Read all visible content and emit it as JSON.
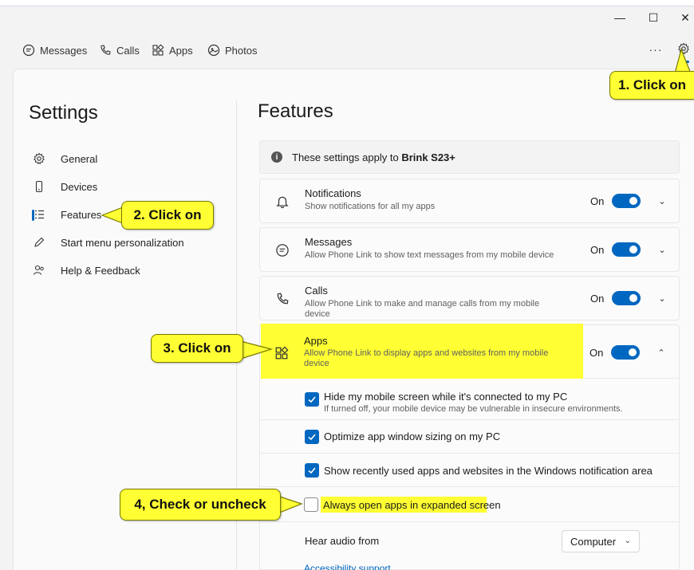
{
  "window": {
    "minimize_label": "—",
    "maximize_label": "☐",
    "close_label": "✕"
  },
  "nav": {
    "items": [
      {
        "label": "Messages",
        "icon": "messages-icon"
      },
      {
        "label": "Calls",
        "icon": "phone-icon"
      },
      {
        "label": "Apps",
        "icon": "apps-icon"
      },
      {
        "label": "Photos",
        "icon": "photos-icon"
      }
    ],
    "more_label": "···"
  },
  "sidebar": {
    "title": "Settings",
    "items": [
      {
        "label": "General",
        "icon": "gear-icon"
      },
      {
        "label": "Devices",
        "icon": "phone-device-icon"
      },
      {
        "label": "Features",
        "icon": "list-icon",
        "selected": true
      },
      {
        "label": "Start menu personalization",
        "icon": "pen-icon"
      },
      {
        "label": "Help & Feedback",
        "icon": "people-icon"
      }
    ]
  },
  "main": {
    "title": "Features",
    "info": {
      "prefix": "These settings apply to ",
      "device": "Brink S23+"
    },
    "features": [
      {
        "title": "Notifications",
        "desc": "Show notifications for all my apps",
        "state": "On",
        "icon": "bell-icon"
      },
      {
        "title": "Messages",
        "desc": "Allow Phone Link to show text messages from my mobile device",
        "state": "On",
        "icon": "chat-icon"
      },
      {
        "title": "Calls",
        "desc": "Allow Phone Link to make and manage calls from my mobile device",
        "state": "On",
        "icon": "phone-icon"
      },
      {
        "title": "Apps",
        "desc": "Allow Phone Link to display apps and websites from my mobile device",
        "state": "On",
        "icon": "apps-icon"
      }
    ],
    "app_options": [
      {
        "label": "Hide my mobile screen while it's connected to my PC",
        "desc": "If turned off, your mobile device may be vulnerable in insecure environments.",
        "checked": true
      },
      {
        "label": "Optimize app window sizing on my PC",
        "checked": true
      },
      {
        "label": "Show recently used apps and websites in the Windows notification area",
        "checked": true
      },
      {
        "label": "Always open apps in expanded screen",
        "checked": false
      }
    ],
    "audio": {
      "label": "Hear audio from",
      "value": "Computer"
    },
    "accessibility_link": "Accessibility support"
  },
  "callouts": {
    "step1": "1. Click on",
    "step2": "2. Click on",
    "step3": "3. Click on",
    "step4": "4, Check or uncheck"
  },
  "colors": {
    "accent": "#0067c0",
    "highlight": "#ffff33"
  }
}
